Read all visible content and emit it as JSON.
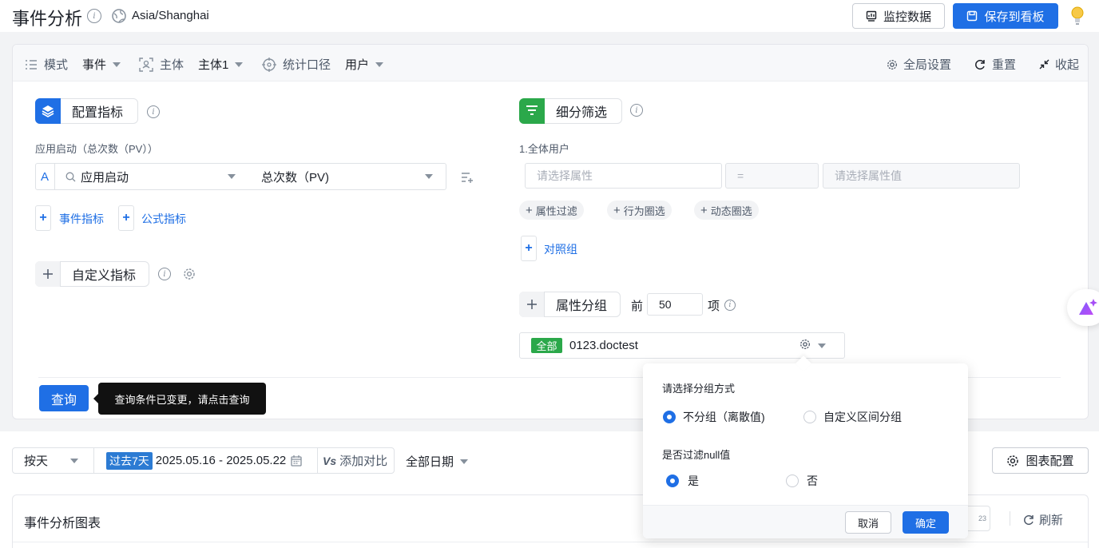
{
  "header": {
    "title": "事件分析",
    "timezone": "Asia/Shanghai",
    "monitor_label": "监控数据",
    "save_label": "保存到看板"
  },
  "modebar": {
    "mode_label": "模式",
    "mode_value": "事件",
    "subject_label": "主体",
    "subject_value": "主体1",
    "stat_label": "统计口径",
    "stat_value": "用户",
    "global_settings": "全局设置",
    "reset": "重置",
    "collapse": "收起"
  },
  "metrics": {
    "section_title": "配置指标",
    "metric_caption": "应用启动（总次数（PV））",
    "metric_letter": "A",
    "event_value": "应用启动",
    "measure_value": "总次数（PV)",
    "add_event_metric": "事件指标",
    "add_formula_metric": "公式指标",
    "custom_metric": "自定义指标"
  },
  "filters": {
    "section_title": "细分筛选",
    "group_caption": "1.全体用户",
    "attr_placeholder": "请选择属性",
    "operator": "=",
    "value_placeholder": "请选择属性值",
    "attr_filter": "属性过滤",
    "behavior_filter": "行为圈选",
    "dynamic_filter": "动态圈选",
    "compare_group": "对照组"
  },
  "grouping": {
    "section_title": "属性分组",
    "top_prefix": "前",
    "top_value": "50",
    "top_suffix": "项",
    "tag": "全部",
    "group_value": "0123.doctest"
  },
  "query": {
    "button": "查询",
    "tooltip": "查询条件已变更，请点击查询"
  },
  "toolbar": {
    "granularity": "按天",
    "range_tag": "过去7天",
    "date_range": "2025.05.16 - 2025.05.22",
    "compare": "添加对比",
    "all_dates": "全部日期",
    "chart_config": "图表配置"
  },
  "chart_panel": {
    "title": "事件分析图表",
    "refresh": "刷新",
    "partial_icon_text": "23"
  },
  "popover": {
    "group_method_label": "请选择分组方式",
    "opt_discrete": "不分组（离散值)",
    "opt_custom_interval": "自定义区间分组",
    "null_filter_label": "是否过滤null值",
    "opt_yes": "是",
    "opt_no": "否",
    "cancel": "取消",
    "confirm": "确定"
  },
  "colors": {
    "primary": "#1f6fe5",
    "green": "#2ba84a",
    "tag_green": "#2ba84a"
  }
}
